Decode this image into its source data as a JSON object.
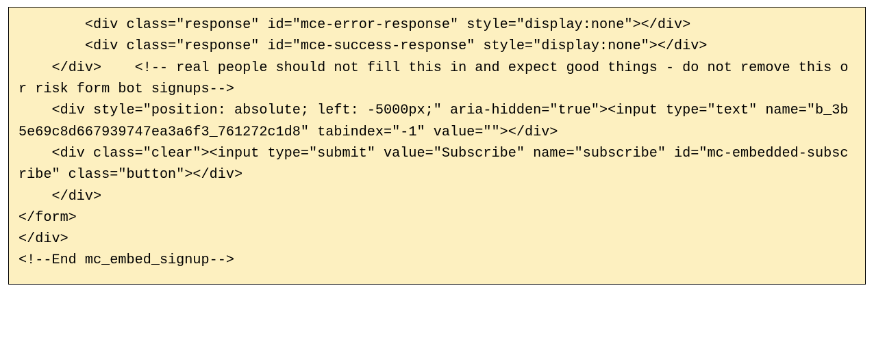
{
  "code": {
    "lines": [
      "        <div class=\"response\" id=\"mce-error-response\" style=\"display:none\"></div>",
      "        <div class=\"response\" id=\"mce-success-response\" style=\"display:none\"></div>",
      "    </div>    <!-- real people should not fill this in and expect good things - do not remove this or risk form bot signups-->",
      "    <div style=\"position: absolute; left: -5000px;\" aria-hidden=\"true\"><input type=\"text\" name=\"b_3b5e69c8d667939747ea3a6f3_761272c1d8\" tabindex=\"-1\" value=\"\"></div>",
      "    <div class=\"clear\"><input type=\"submit\" value=\"Subscribe\" name=\"subscribe\" id=\"mc-embedded-subscribe\" class=\"button\"></div>",
      "    </div>",
      "</form>",
      "</div>",
      "<!--End mc_embed_signup-->"
    ]
  }
}
